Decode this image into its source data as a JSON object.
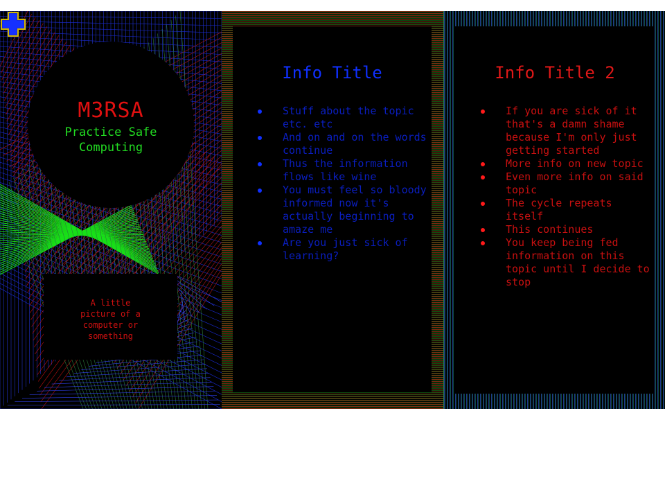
{
  "cover": {
    "title": "M3RSA",
    "tagline": "Practice Safe Computing",
    "picture_caption": "A little picture of a computer or something",
    "icon": "plus-cross-icon"
  },
  "middle": {
    "title": "Info Title",
    "bullets": [
      "Stuff about the topic etc. etc",
      "And on and on the words continue",
      "Thus the information flows like wine",
      "You must feel so bloody informed now it's actually beginning to amaze me",
      "Are you just sick of learning?"
    ]
  },
  "right": {
    "title": "Info Title 2",
    "bullets": [
      "If you are sick of it that's a damn shame because I'm only just getting started",
      "More info on new topic",
      "Even more info on said topic",
      "The cycle repeats itself",
      "This continues",
      "You keep being fed information on this topic until I decide to stop"
    ]
  },
  "colors": {
    "title_red": "#e01010",
    "tagline_green": "#22dd22",
    "middle_text_blue": "#0a1ec0",
    "right_text_red": "#c81010"
  }
}
